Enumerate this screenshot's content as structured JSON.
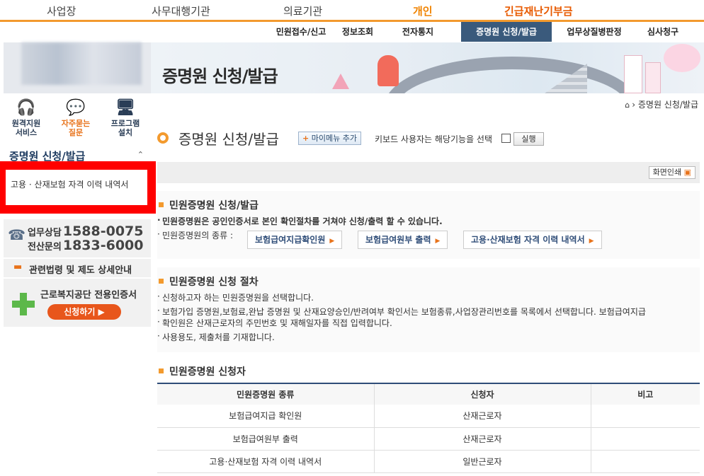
{
  "top_categories": {
    "cat1": "사업장",
    "cat2": "사무대행기관",
    "cat3": "의료기관",
    "cat4": "개인",
    "cat5": "긴급재난기부금"
  },
  "submenu": {
    "m1": "민원접수/신고",
    "m2": "정보조회",
    "m3": "전자통지",
    "m4": "증명원 신청/발급",
    "m5": "업무상질병판정",
    "m6": "심사청구"
  },
  "banner": {
    "title": "증명원 신청/발급"
  },
  "quick_links": {
    "remote": "원격지원\n서비스",
    "faq": "자주묻는\n질문",
    "program": "프로그램\n설치"
  },
  "lnb": {
    "title": "증명원 신청/발급",
    "item1": "고용 · 산재보험 자격 이력 내역서"
  },
  "call": {
    "label1": "업무상담",
    "num1": "1588-0075",
    "label2": "전산문의",
    "num2": "1833-6000"
  },
  "law_link": "관련법령 및 제도 상세안내",
  "cert": {
    "title": "근로복지공단 전용인증서",
    "button": "신청하기 ▶"
  },
  "breadcrumb": "증명원 신청/발급",
  "page_title": "증명원 신청/발급",
  "my_menu_add": "마이메뉴 추가",
  "keyboard_text": "키보드 사용자는 해당기능을 선택",
  "run_button": "실행",
  "print_button": "화면인쇄",
  "section1": {
    "heading": "민원증명원 신청/발급",
    "line1": "민원증명원은 공인인증서로 본인 확인절차를 거쳐야 신청/출력 할 수 있습니다.",
    "line2": "민원증명원의 종류 :",
    "btn1": "보험급여지급확인원",
    "btn2": "보험급여원부 출력",
    "btn3": "고용·산재보험 자격 이력 내역서"
  },
  "section2": {
    "heading": "민원증명원 신청 절차",
    "line1": "신청하고자 하는 민원증명원을 선택합니다.",
    "line2a": "보험가입 증명원,보험료,완납 증명원 및 산재요양승인/반려여부 확인서는 보험종류,사업장관리번호를 목록에서 선택합니다. 보험급여지급",
    "line2b": "확인원은 산재근로자의 주민번호 및 재해일자를 직접 입력합니다.",
    "line3": "사용용도, 제출처를 기재합니다."
  },
  "section3": {
    "heading": "민원증명원 신청자"
  },
  "table": {
    "headers": [
      "민원증명원 종류",
      "신청자",
      "비고"
    ],
    "rows": [
      [
        "보험급여지급 확인원",
        "산재근로자",
        ""
      ],
      [
        "보험급여원부 출력",
        "산재근로자",
        ""
      ],
      [
        "고용·산재보험 자격 이력 내역서",
        "일반근로자",
        ""
      ]
    ]
  },
  "colors": {
    "accent": "#f39a2e",
    "nav_active": "#3a5a7c",
    "highlight": "#ff0000"
  }
}
